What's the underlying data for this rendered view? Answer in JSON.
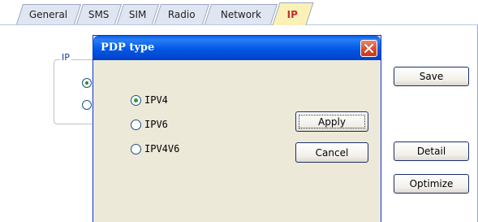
{
  "tabs": [
    {
      "label": "General",
      "active": false
    },
    {
      "label": "SMS",
      "active": false
    },
    {
      "label": "SIM",
      "active": false
    },
    {
      "label": "Radio",
      "active": false
    },
    {
      "label": "Network",
      "active": false
    },
    {
      "label": "IP",
      "active": true
    }
  ],
  "page": {
    "group_label": "IP",
    "save_label": "Save",
    "detail_label": "Detail",
    "optimize_label": "Optimize"
  },
  "dialog": {
    "title": "PDP type",
    "options": [
      {
        "label": "IPV4",
        "selected": true
      },
      {
        "label": "IPV6",
        "selected": false
      },
      {
        "label": "IPV4V6",
        "selected": false
      }
    ],
    "apply_label": "Apply",
    "cancel_label": "Cancel"
  },
  "colors": {
    "titlebar": "#0058e6",
    "close": "#d9472a",
    "dialog_bg": "#ece9d8",
    "active_tab": "#fbf1b6",
    "accent": "#1c3aa8"
  }
}
